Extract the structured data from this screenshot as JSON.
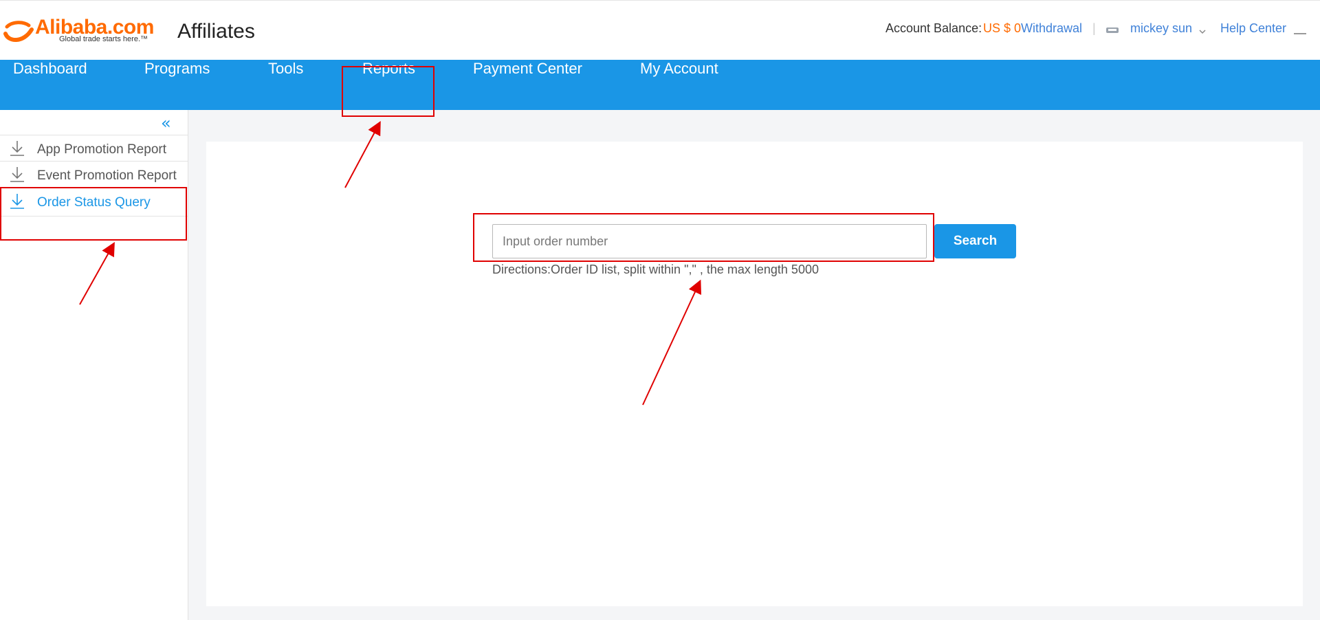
{
  "header": {
    "logo_text": "Alibaba.com",
    "logo_tagline": "Global trade starts here.™",
    "app_name": "Affiliates",
    "balance_label": "Account Balance:",
    "balance_value": "US $ 0",
    "withdraw_label": "Withdrawal",
    "separator": "|",
    "user_name": "mickey sun",
    "help_label": "Help Center"
  },
  "nav": {
    "items": [
      {
        "label": "Dashboard"
      },
      {
        "label": "Programs"
      },
      {
        "label": "Tools"
      },
      {
        "label": "Reports"
      },
      {
        "label": "Payment Center"
      },
      {
        "label": "My Account"
      }
    ]
  },
  "sidebar": {
    "collapse_glyph": "«",
    "items": [
      {
        "label": "App Promotion Report",
        "icon": "download-icon"
      },
      {
        "label": "Event Promotion Report",
        "icon": "download-icon"
      },
      {
        "label": "Order Status Query",
        "icon": "download-icon",
        "active": true
      }
    ]
  },
  "main": {
    "search_placeholder": "Input order number",
    "search_value": "",
    "search_button": "Search",
    "directions": "Directions:Order ID list, split within \",\" , the max length 5000"
  },
  "colors": {
    "brand_orange": "#ff6a00",
    "nav_blue": "#1a96e6",
    "link_blue": "#3f81d8",
    "annotation_red": "#e00000"
  }
}
